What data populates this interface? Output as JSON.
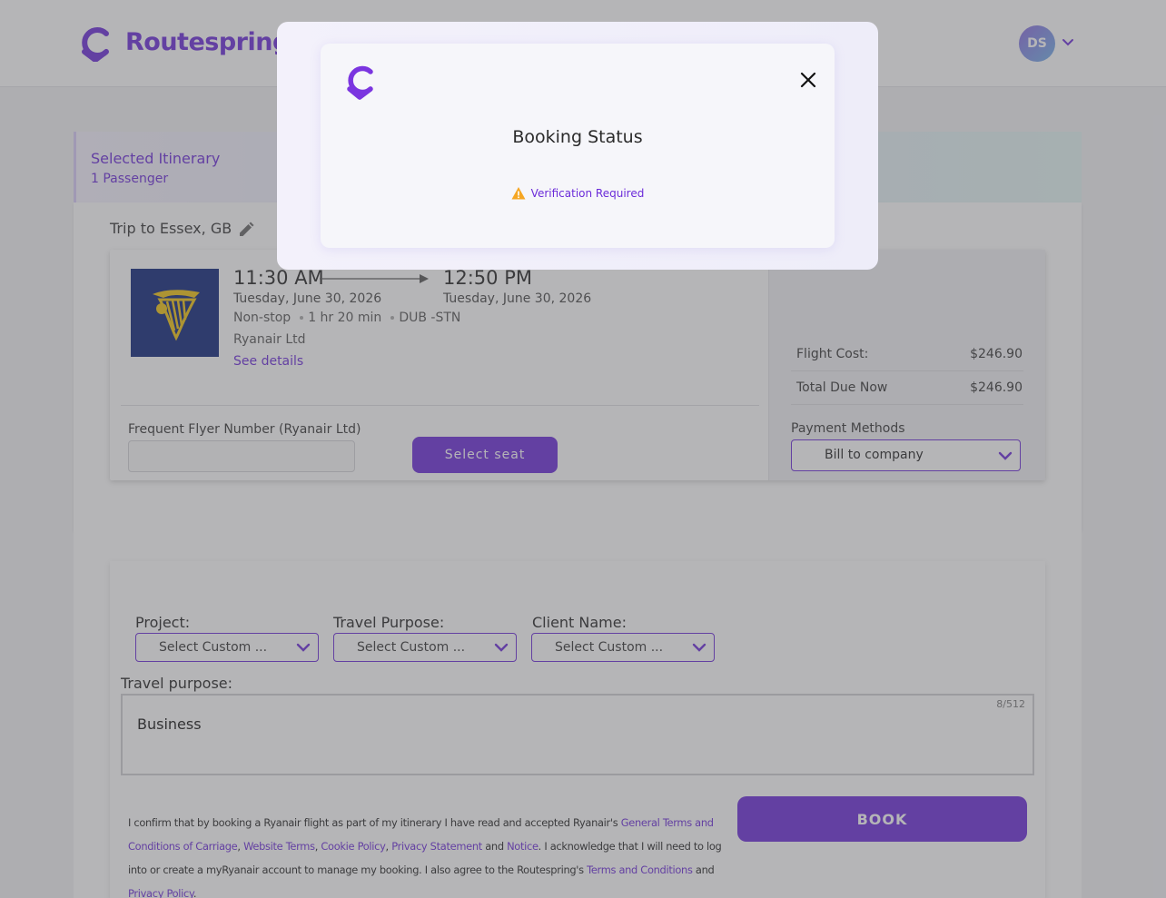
{
  "header": {
    "brand_name": "Routespring",
    "avatar_initials": "DS"
  },
  "itinerary": {
    "title": "Selected Itinerary",
    "passengers": "1 Passenger",
    "trip_title": "Trip to Essex, GB"
  },
  "flight": {
    "departure_time": "11:30 AM",
    "arrival_time": "12:50 PM",
    "departure_date": "Tuesday, June 30, 2026",
    "arrival_date": "Tuesday, June 30, 2026",
    "stops": "Non-stop",
    "duration": "1 hr 20 min",
    "route": "DUB -STN",
    "airline": "Ryanair Ltd",
    "see_details": "See details",
    "frequent_flyer_label": "Frequent Flyer Number (Ryanair Ltd)",
    "frequent_flyer_value": "",
    "select_seat": "Select seat"
  },
  "costs": {
    "flight_cost_label": "Flight Cost:",
    "flight_cost_value": "$246.90",
    "total_due_label": "Total Due Now",
    "total_due_value": "$246.90",
    "payment_methods_label": "Payment Methods",
    "payment_method_selected": "Bill to company"
  },
  "form": {
    "project_label": "Project:",
    "project_value": "Select Custom ...",
    "travel_purpose_label": "Travel Purpose:",
    "travel_purpose_value": "Select Custom ...",
    "client_name_label": "Client Name:",
    "client_name_value": "Select Custom ...",
    "purpose_text_label": "Travel purpose:",
    "purpose_text_value": "Business",
    "purpose_count": "8/512",
    "book_label": "BOOK"
  },
  "terms": {
    "p1": "I confirm that by booking a Ryanair flight as part of my itinerary I have read and accepted Ryanair's ",
    "l1": "General Terms and Conditions of Carriage",
    "s1": ", ",
    "l2": "Website Terms",
    "s2": ", ",
    "l3": "Cookie Policy",
    "s3": ", ",
    "l4": "Privacy Statement",
    "s4": " and ",
    "l5": "Notice",
    "p2": ". I acknowledge that I will need to log into or create a myRyanair account to manage my booking. I also agree to the Routespring's ",
    "l6": "Terms and Conditions",
    "s5": " and ",
    "l7": "Privacy Policy",
    "p3": "."
  },
  "modal": {
    "title": "Booking Status",
    "status": "Verification Required"
  },
  "colors": {
    "brand_purple": "#6b2bd9",
    "warning": "#f5a623"
  },
  "icons": {
    "brand": "routespring-logo-icon",
    "avatar_menu": "chevron-down-icon",
    "edit": "pencil-icon",
    "close": "close-icon",
    "warning": "warning-icon"
  }
}
